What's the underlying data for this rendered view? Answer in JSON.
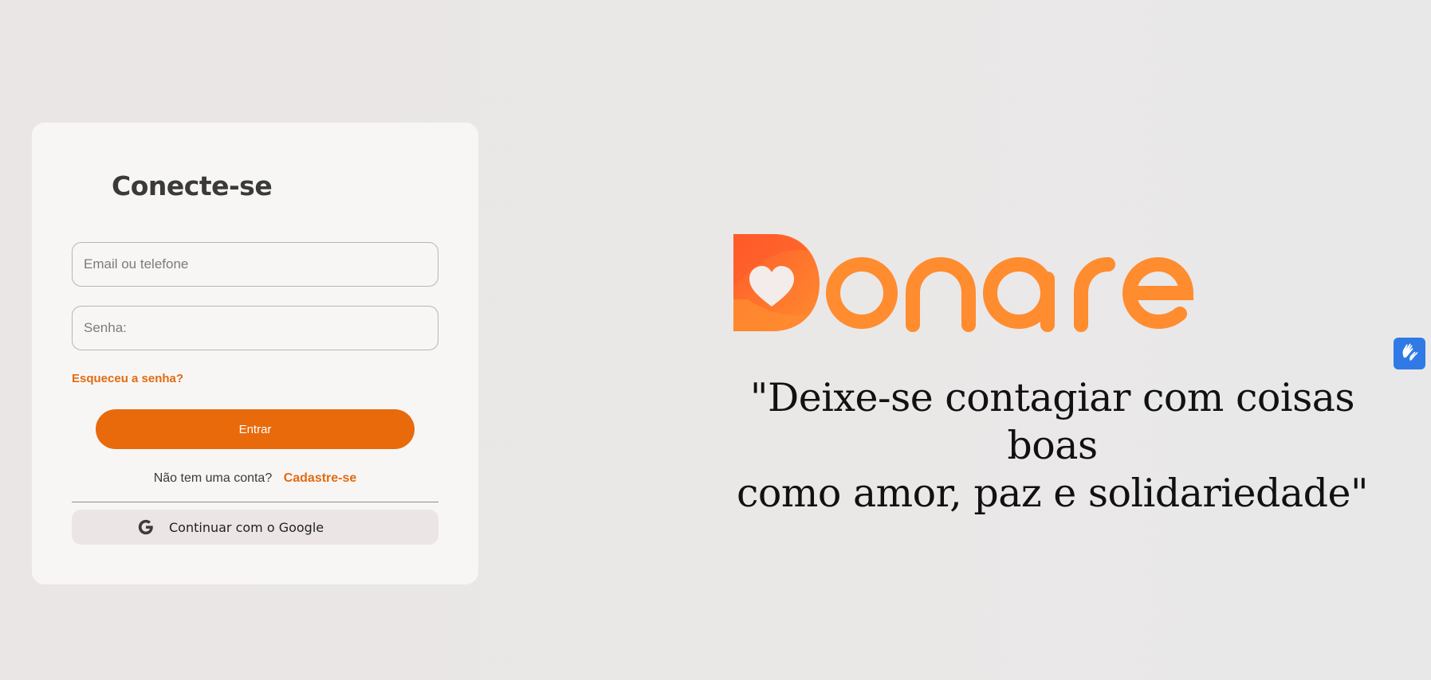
{
  "login": {
    "title": "Conecte-se",
    "email_placeholder": "Email ou telefone",
    "password_placeholder": "Senha:",
    "forgot_label": "Esqueceu a senha?",
    "enter_label": "Entrar",
    "no_account_text": "Não tem uma conta?",
    "signup_label": "Cadastre-se",
    "google_label": "Continuar com o Google"
  },
  "brand": {
    "logo_text": "Donare",
    "quote_line1": "\"Deixe-se contagiar com coisas boas",
    "quote_line2": "como amor, paz e solidariedade\""
  },
  "accessibility": {
    "icon": "sign-language-hands-icon"
  },
  "colors": {
    "accent": "#e86a0b",
    "logo_orange": "#ff8c2f",
    "logo_red": "#ff5a2a",
    "access_blue": "#2f7ae5"
  }
}
